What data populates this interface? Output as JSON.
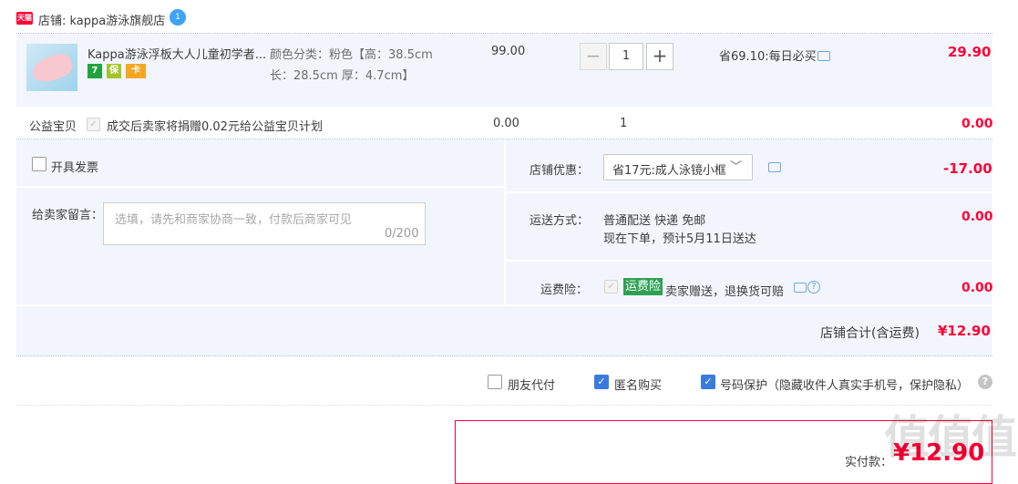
{
  "shop": {
    "badge": "天猫",
    "name": "店铺: kappa游泳旗舰店",
    "ww_icon": "1"
  },
  "item": {
    "title": "Kappa游泳浮板大人儿童初学者...",
    "tags": [
      "7",
      "保",
      "卡"
    ],
    "sku_line1": "颜色分类：粉色【高：38.5cm",
    "sku_line2": "长：28.5cm 厚：4.7cm】",
    "price": "99.00",
    "qty": "1",
    "minus": "−",
    "plus": "+",
    "saving": "省69.10:每日必买",
    "subtotal": "29.90"
  },
  "charity": {
    "label": "公益宝贝",
    "text": "成交后卖家将捐赠0.02元给公益宝贝计划",
    "price": "0.00",
    "qty": "1",
    "subtotal": "0.00"
  },
  "invoice": {
    "label": "开具发票"
  },
  "message": {
    "label": "给卖家留言：",
    "placeholder": "选填，请先和商家协商一致，付款后商家可见",
    "count": "0/200"
  },
  "coupon": {
    "label": "店铺优惠：",
    "selected": "省17元:成人泳镜小框",
    "amount": "-17.00"
  },
  "shipping": {
    "label": "运送方式：",
    "line1": "普通配送 快递 免邮",
    "line2": "现在下单，预计5月11日送达",
    "amount": "0.00"
  },
  "insurance": {
    "label": "运费险：",
    "badge": "运费险",
    "text": "卖家赠送，退换货可赔",
    "amount": "0.00"
  },
  "shop_total": {
    "label": "店铺合计(含运费)",
    "amount": "¥12.90"
  },
  "bottom_options": {
    "friend_pay": "朋友代付",
    "anonymous": "匿名购买",
    "number_protect": "号码保护（隐藏收件人真实手机号，保护隐私）",
    "help": "?"
  },
  "payment": {
    "label": "实付款：",
    "amount": "¥12.90"
  },
  "watermark": "值值值",
  "colors": {
    "accent_red": "#ff0036",
    "panel_bg": "#f2f6fc",
    "checkbox_blue": "#3a7be0",
    "insurance_green": "#2fa155"
  }
}
